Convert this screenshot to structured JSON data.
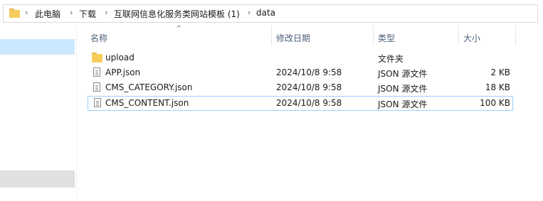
{
  "breadcrumbs": [
    "此电脑",
    "下载",
    "互联网信息化服务类网站模板 (1)",
    "data"
  ],
  "columns": {
    "name": "名称",
    "date": "修改日期",
    "type": "类型",
    "size": "大小"
  },
  "files": [
    {
      "name": "upload",
      "date": "",
      "type": "文件夹",
      "size": "",
      "icon": "folder-icon"
    },
    {
      "name": "APP.json",
      "date": "2024/10/8 9:58",
      "type": "JSON 源文件",
      "size": "2 KB",
      "icon": "json-file-icon"
    },
    {
      "name": "CMS_CATEGORY.json",
      "date": "2024/10/8 9:58",
      "type": "JSON 源文件",
      "size": "18 KB",
      "icon": "json-file-icon"
    },
    {
      "name": "CMS_CONTENT.json",
      "date": "2024/10/8 9:58",
      "type": "JSON 源文件",
      "size": "100 KB",
      "icon": "json-file-icon"
    }
  ],
  "selected_row": 3,
  "colors": {
    "nav_selected": "#cce8ff",
    "row_selected_border": "#99d1ff",
    "folder": "#f6cd5c",
    "header_text": "#4c607a"
  }
}
